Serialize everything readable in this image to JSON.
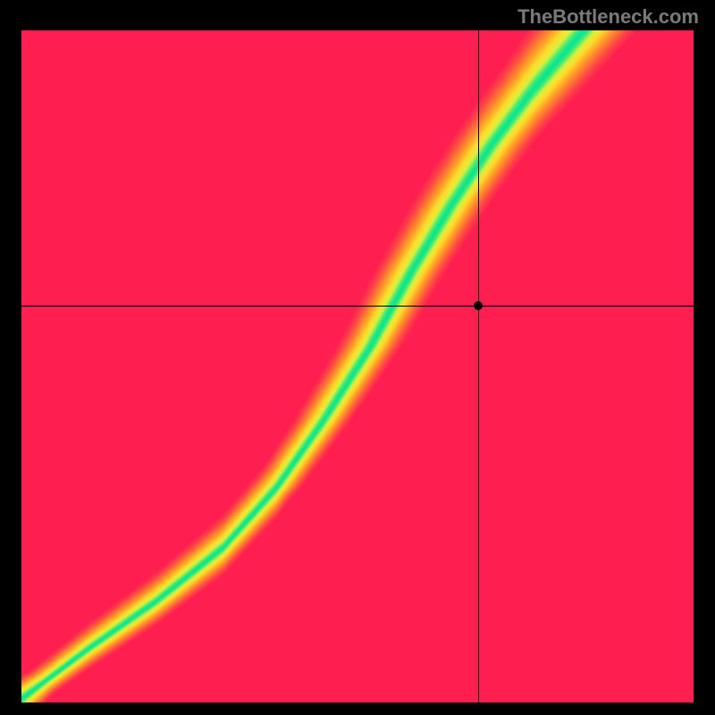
{
  "watermark": "TheBottleneck.com",
  "chart_data": {
    "type": "heatmap",
    "title": "",
    "xlabel": "",
    "ylabel": "",
    "xlim": [
      0,
      1
    ],
    "ylim": [
      0,
      1
    ],
    "marker": {
      "x": 0.68,
      "y": 0.59
    },
    "crosshair": {
      "x": 0.68,
      "y": 0.59
    },
    "colorscale_description": "Red (mismatch) → Orange → Yellow → Green (balanced)",
    "ridge_curve_notes": "Green ridge represents optimal pairing; curve passes roughly through origin diagonally with slight S-curve, steeper in upper half",
    "ridge_curve": [
      {
        "x": 0.02,
        "y": 0.02
      },
      {
        "x": 0.1,
        "y": 0.08
      },
      {
        "x": 0.2,
        "y": 0.15
      },
      {
        "x": 0.3,
        "y": 0.23
      },
      {
        "x": 0.38,
        "y": 0.32
      },
      {
        "x": 0.45,
        "y": 0.42
      },
      {
        "x": 0.52,
        "y": 0.53
      },
      {
        "x": 0.58,
        "y": 0.64
      },
      {
        "x": 0.64,
        "y": 0.74
      },
      {
        "x": 0.7,
        "y": 0.83
      },
      {
        "x": 0.76,
        "y": 0.91
      },
      {
        "x": 0.82,
        "y": 0.98
      }
    ],
    "ridge_width_base": 0.06
  }
}
